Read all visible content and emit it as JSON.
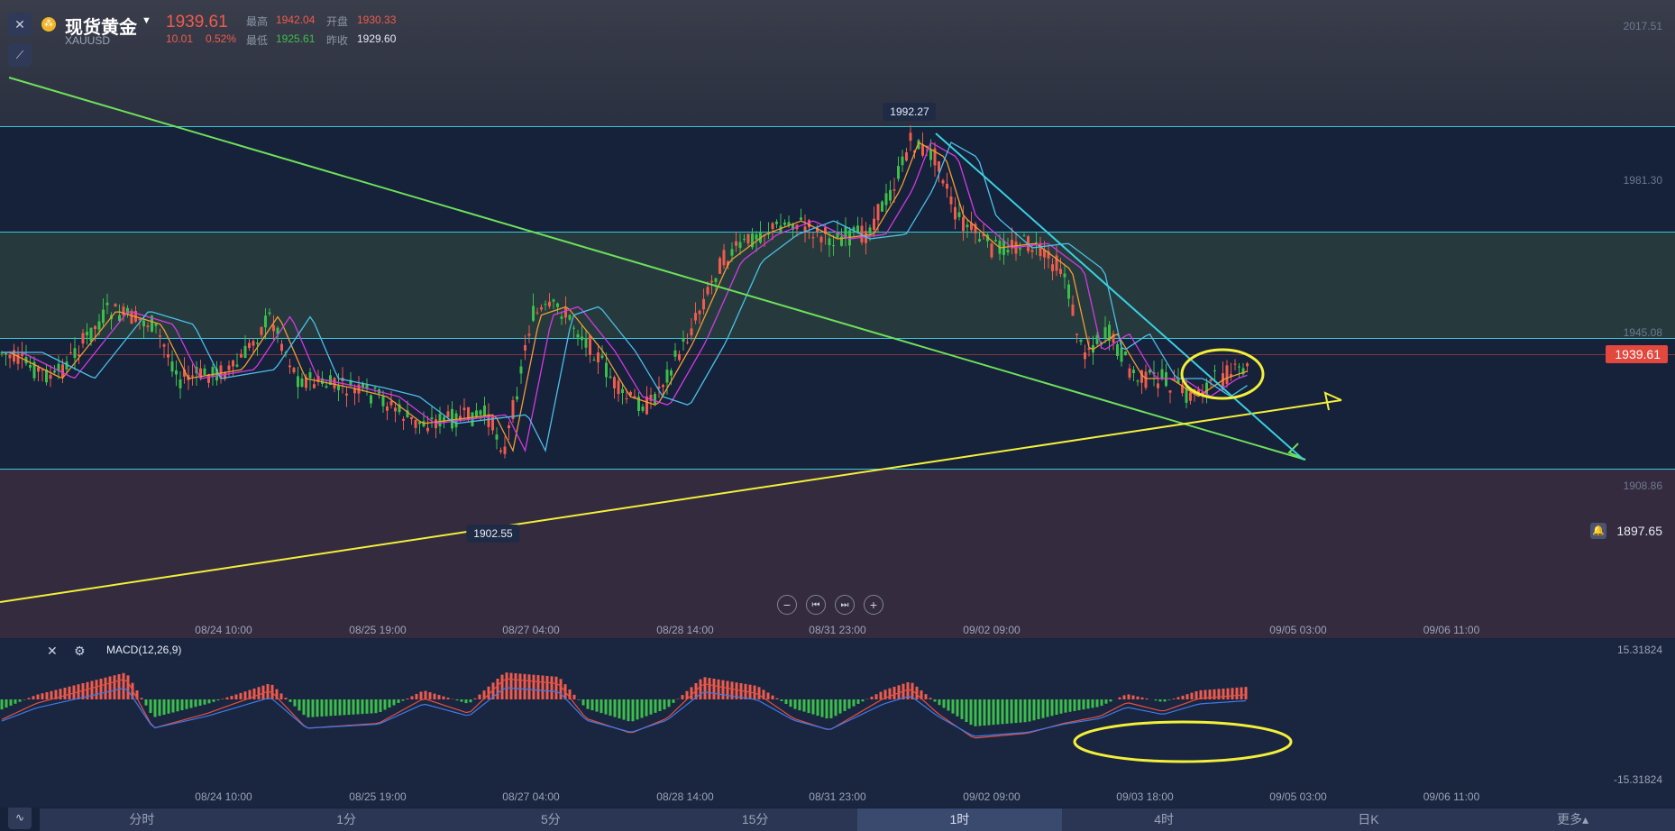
{
  "header": {
    "symbol_name": "现货黄金",
    "symbol_code": "XAUUSD",
    "last_price": "1939.61",
    "change": "10.01",
    "change_pct": "0.52%",
    "high_label": "最高",
    "high_value": "1942.04",
    "open_label": "开盘",
    "open_value": "1930.33",
    "low_label": "最低",
    "low_value": "1925.61",
    "prev_close_label": "昨收",
    "prev_close_value": "1929.60"
  },
  "price_axis": [
    "2017.51",
    "1981.30",
    "1945.08",
    "1908.86"
  ],
  "current_price_tag": "1939.61",
  "alert_price": "1897.65",
  "annotations": {
    "peak": "1992.27",
    "trough": "1902.55"
  },
  "x_axis": [
    "08/24 10:00",
    "08/25 19:00",
    "08/27 04:00",
    "08/28 14:00",
    "08/31 23:00",
    "09/02 09:00",
    "09/05 03:00",
    "09/06 11:00"
  ],
  "x_axis_macd": [
    "08/24 10:00",
    "08/25 19:00",
    "08/27 04:00",
    "08/28 14:00",
    "08/31 23:00",
    "09/02 09:00",
    "09/03 18:00",
    "09/05 03:00",
    "09/06 11:00"
  ],
  "macd": {
    "title": "MACD(12,26,9)",
    "axis_top": "15.31824",
    "axis_bottom": "-15.31824"
  },
  "nav_controls": [
    "−",
    "⏮",
    "⏭",
    "+"
  ],
  "timeframes": [
    "分时",
    "1分",
    "5分",
    "15分",
    "1时",
    "4时",
    "日K",
    "更多▴"
  ],
  "active_timeframe": "1时",
  "colors": {
    "up": "#ef5b4c",
    "down": "#3cbf4a",
    "bg": "#16213a",
    "level_line": "#37c8d8",
    "trend_green": "#6ee05a",
    "trend_yellow": "#f3f03a",
    "trend_cyan": "#3ad0e0"
  }
}
